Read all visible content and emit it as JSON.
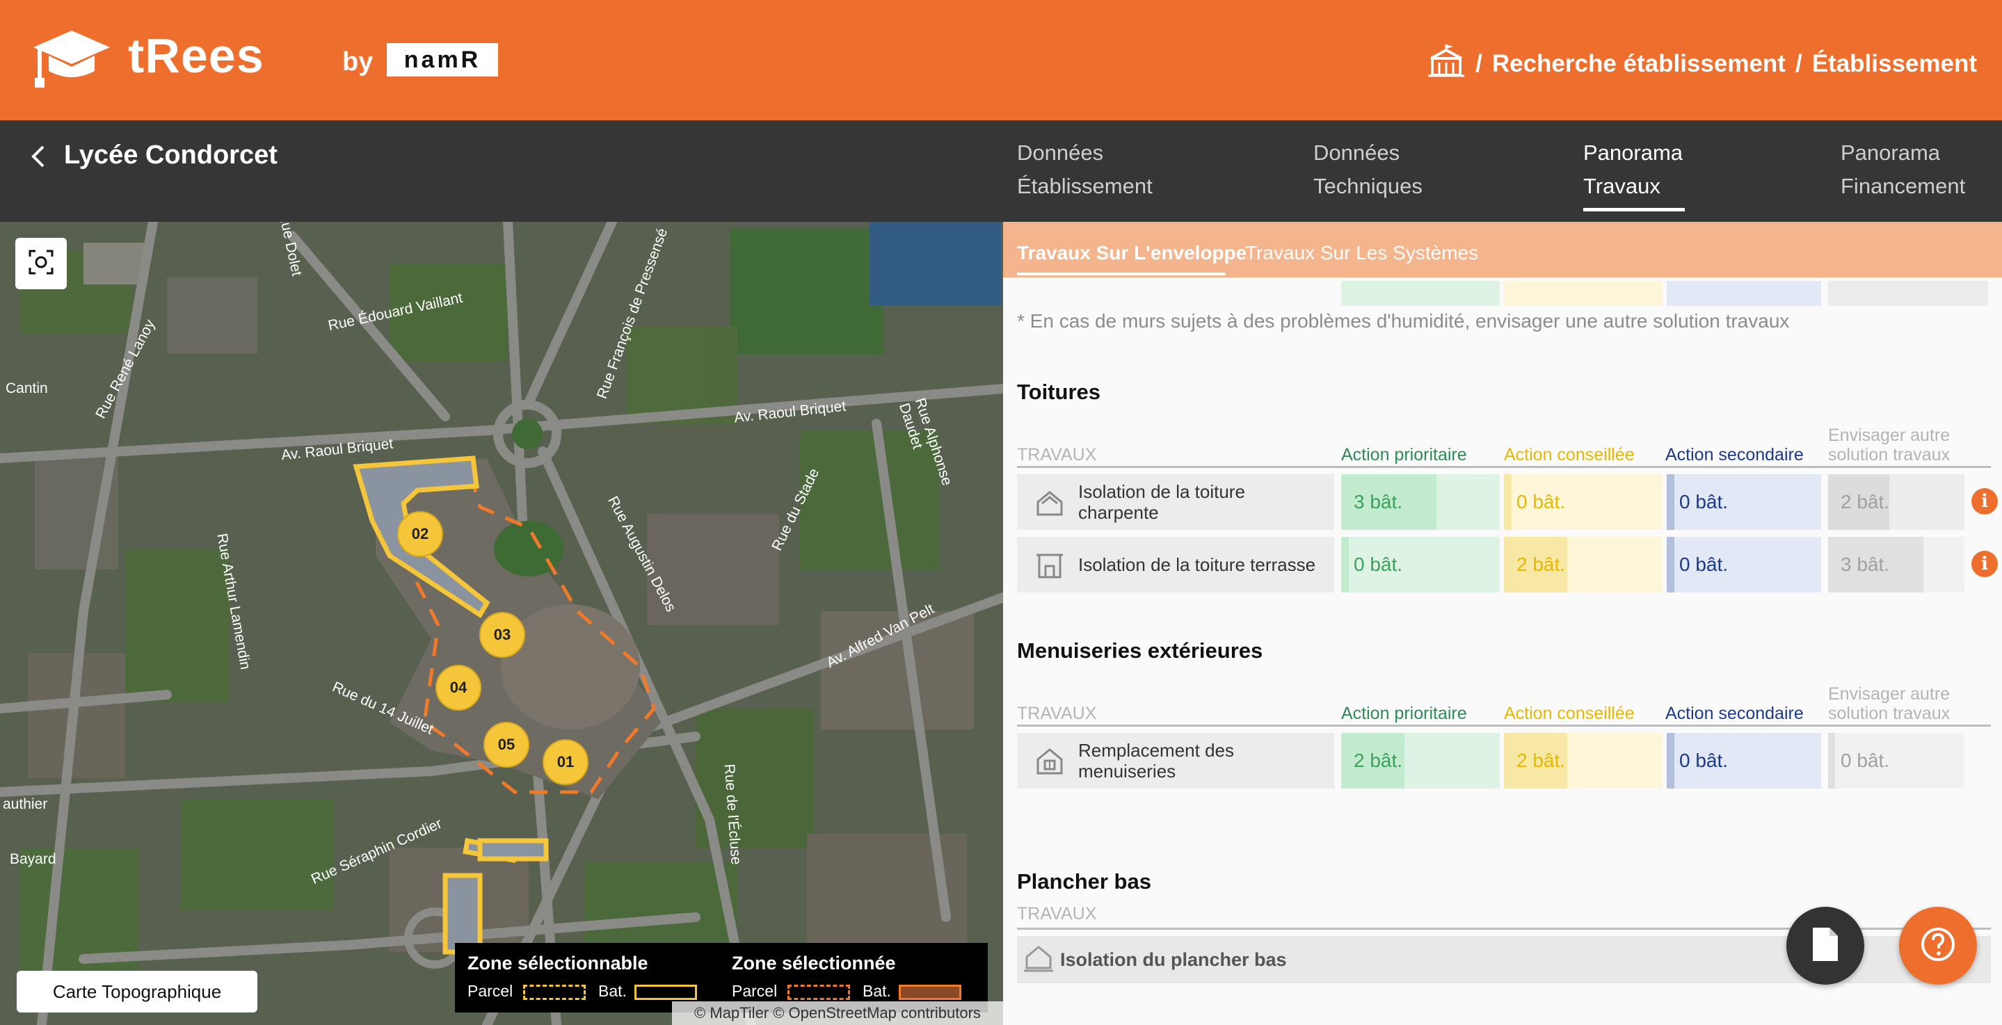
{
  "header": {
    "brand": "tRees",
    "by": "by",
    "partner": "namR",
    "breadcrumb": {
      "sep1": "/",
      "item1": "Recherche établissement",
      "sep2": "/",
      "item2": "Établissement"
    }
  },
  "subheader": {
    "establishment": "Lycée Condorcet",
    "tabs": [
      {
        "line1": "Données",
        "line2": "Établissement"
      },
      {
        "line1": "Données",
        "line2": "Techniques"
      },
      {
        "line1": "Panorama",
        "line2": "Travaux"
      },
      {
        "line1": "Panorama",
        "line2": "Financement"
      }
    ],
    "active_tab": "Panorama Travaux"
  },
  "map": {
    "streets": [
      "Rue Édouard Vaillant",
      "Av. Raoul Briquet",
      "Av. Raoul Briquet",
      "Rue Augustin Delos",
      "Rue du Stade",
      "Rue du 14 Juillet",
      "Rue Séraphin Cordier",
      "Av. Alfred Van Pelt",
      "Rue Alphonse Daudet",
      "Rue Arthur Lamendin",
      "Rue René Lanoy",
      "Rue François de Pressensé",
      "Rue de l'Écluse",
      "Rue Dolet",
      "Cantin",
      "Bayard",
      "authier"
    ],
    "building_markers": [
      "02",
      "03",
      "04",
      "05",
      "01"
    ],
    "topo_button": "Carte Topographique",
    "legend": {
      "selectable_title": "Zone sélectionnable",
      "selected_title": "Zone sélectionnée",
      "parcel": "Parcel",
      "bat": "Bat."
    },
    "attribution": "© MapTiler © OpenStreetMap contributors"
  },
  "panel": {
    "subtabs": [
      "Travaux Sur L'enveloppe",
      "Travaux Sur Les Systèmes"
    ],
    "note": "* En cas de murs sujets à des problèmes d'humidité, envisager une autre solution travaux",
    "columns": {
      "travaux": "TRAVAUX",
      "prioritaire": "Action prioritaire",
      "conseillee": "Action conseillée",
      "secondaire": "Action secondaire",
      "autre_line1": "Envisager autre",
      "autre_line2": "solution travaux"
    },
    "sections": [
      {
        "title": "Toitures",
        "rows": [
          {
            "label": "Isolation de la toiture charpente",
            "icon": "roof-house-icon",
            "prioritaire": "3 bât.",
            "prioritaire_fill": 0.6,
            "conseillee": "0 bât.",
            "conseillee_fill": 0.05,
            "secondaire": "0 bât.",
            "secondaire_fill": 0.05,
            "autre": "2 bât.",
            "autre_fill": 0.4
          },
          {
            "label": "Isolation de la toiture terrasse",
            "icon": "flat-roof-building-icon",
            "prioritaire": "0 bât.",
            "prioritaire_fill": 0.05,
            "conseillee": "2 bât.",
            "conseillee_fill": 0.4,
            "secondaire": "0 bât.",
            "secondaire_fill": 0.05,
            "autre": "3 bât.",
            "autre_fill": 0.6
          }
        ]
      },
      {
        "title": "Menuiseries extérieures",
        "rows": [
          {
            "label": "Remplacement des menuiseries",
            "icon": "window-house-icon",
            "prioritaire": "2 bât.",
            "prioritaire_fill": 0.4,
            "conseillee": "2 bât.",
            "conseillee_fill": 0.4,
            "secondaire": "0 bât.",
            "secondaire_fill": 0.05,
            "autre": "0 bât.",
            "autre_fill": 0.0
          }
        ]
      },
      {
        "title": "Plancher bas",
        "rows": [
          {
            "label": "Isolation du plancher bas",
            "icon": "floor-house-icon"
          }
        ]
      }
    ],
    "info_glyph": "i"
  },
  "colors": {
    "brand_orange": "#ee6f2d",
    "dark_bar": "#363636",
    "prioritaire": "#3aa25a",
    "conseillee": "#e6b800",
    "secondaire": "#1c3a8c",
    "autre": "#a0a0a0"
  }
}
